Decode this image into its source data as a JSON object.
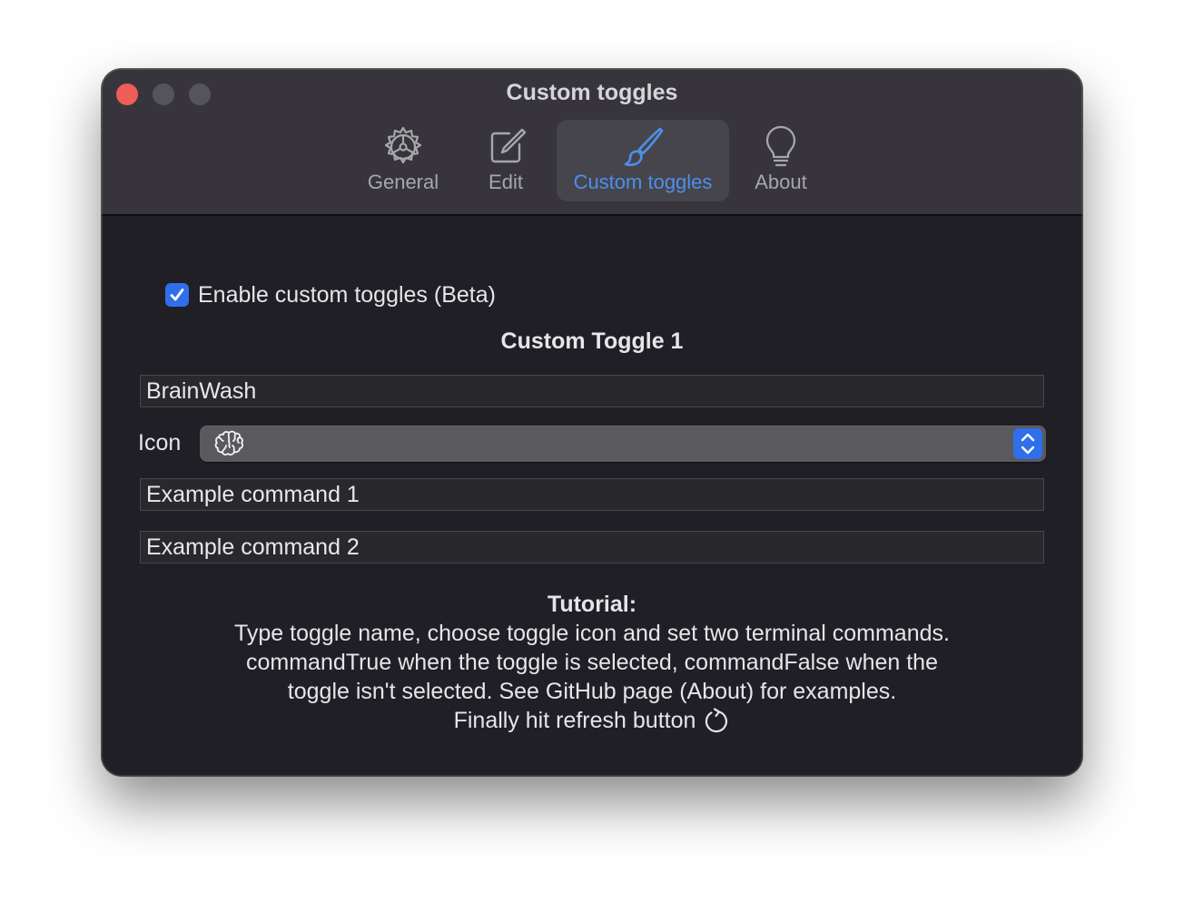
{
  "window": {
    "title": "Custom toggles"
  },
  "toolbar": {
    "tabs": [
      {
        "label": "General",
        "icon": "gear-icon",
        "active": false
      },
      {
        "label": "Edit",
        "icon": "edit-square-icon",
        "active": false
      },
      {
        "label": "Custom toggles",
        "icon": "paintbrush-icon",
        "active": true
      },
      {
        "label": "About",
        "icon": "lightbulb-icon",
        "active": false
      }
    ]
  },
  "content": {
    "enable_checkbox": {
      "label": "Enable custom toggles (Beta)",
      "checked": true
    },
    "section_title": "Custom Toggle 1",
    "toggle_name": "BrainWash",
    "icon_label": "Icon",
    "icon_popup": {
      "selected_icon": "brain-icon"
    },
    "command_true": "Example command 1",
    "command_false": "Example command 2",
    "tutorial": {
      "title": "Tutorial:",
      "line1": "Type toggle name, choose toggle icon and set two terminal commands.",
      "line2": "commandTrue when the toggle is selected, commandFalse when the",
      "line3": "toggle isn't selected. See GitHub page (About) for examples.",
      "line4": "Finally hit refresh button",
      "line4_icon": "refresh-icon"
    }
  },
  "colors": {
    "accent": "#2f6fea",
    "active_tab_text": "#4c8fee",
    "close_button": "#ee5d57",
    "window_bg": "#201f25",
    "titlebar_bg": "#37353b"
  }
}
